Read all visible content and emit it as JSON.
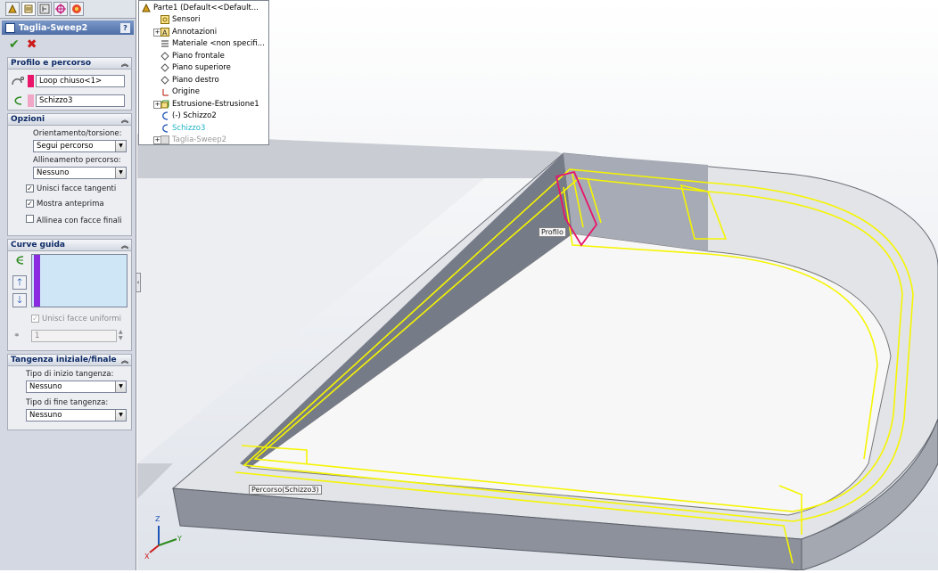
{
  "panel": {
    "title": "Taglia-Sweep2",
    "help": "?",
    "tab_icons": [
      "feature-manager-icon",
      "property-manager-icon",
      "configuration-manager-icon",
      "dimxpert-icon",
      "display-manager-icon"
    ],
    "groups": {
      "profile_path": {
        "title": "Profilo e percorso",
        "profile_value": "Loop chiuso<1>",
        "path_value": "Schizzo3",
        "profile_color": "#e8156b",
        "path_color": "#f0a6c6"
      },
      "options": {
        "title": "Opzioni",
        "orient_label": "Orientamento/torsione:",
        "orient_value": "Segui percorso",
        "align_label": "Allineamento percorso:",
        "align_value": "Nessuno",
        "merge_tangent": "Unisci facce tangenti",
        "show_preview": "Mostra anteprima",
        "align_end": "Allinea con facce finali"
      },
      "guides": {
        "title": "Curve guida",
        "merge_smooth": "Unisci facce uniformi",
        "count_value": "1",
        "bar_color": "#8a2be2"
      },
      "tangency": {
        "title": "Tangenza iniziale/finale",
        "start_label": "Tipo di inizio tangenza:",
        "start_value": "Nessuno",
        "end_label": "Tipo di fine tangenza:",
        "end_value": "Nessuno"
      }
    }
  },
  "tree": {
    "root": "Parte1  (Default<<Default...",
    "items": [
      "Sensori",
      "Annotazioni",
      "Materiale <non specifi...",
      "Piano frontale",
      "Piano superiore",
      "Piano destro",
      "Origine",
      "Estrusione-Estrusione1",
      "(-) Schizzo2",
      "Schizzo3",
      "Taglia-Sweep2"
    ],
    "highlight_color": "#1fb3c8"
  },
  "viewport": {
    "profile_tag": "Profilo",
    "path_tag": "Percorso(Schizzo3)",
    "triad_x": "X",
    "triad_y": "Y",
    "triad_z": "Z",
    "preview_color": "#f5f500"
  }
}
